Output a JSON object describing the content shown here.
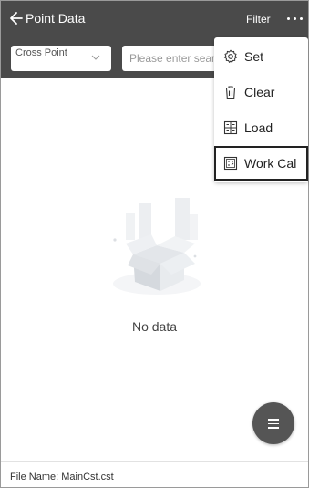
{
  "header": {
    "title": "Point Data",
    "filter_label": "Filter",
    "more_icon": "more-dots-icon"
  },
  "toolbar": {
    "select_value": "Cross Point",
    "search_placeholder": "Please enter sear"
  },
  "menu": {
    "items": [
      {
        "label": "Set",
        "icon": "gear-icon"
      },
      {
        "label": "Clear",
        "icon": "trash-icon"
      },
      {
        "label": "Load",
        "icon": "load-icon"
      },
      {
        "label": "Work Cal",
        "icon": "calculator-icon"
      }
    ]
  },
  "main": {
    "empty_text": "No data"
  },
  "footer": {
    "file_name": "File Name: MainCst.cst"
  },
  "colors": {
    "header_bg": "#4a4a4a",
    "fab_bg": "#555555"
  }
}
